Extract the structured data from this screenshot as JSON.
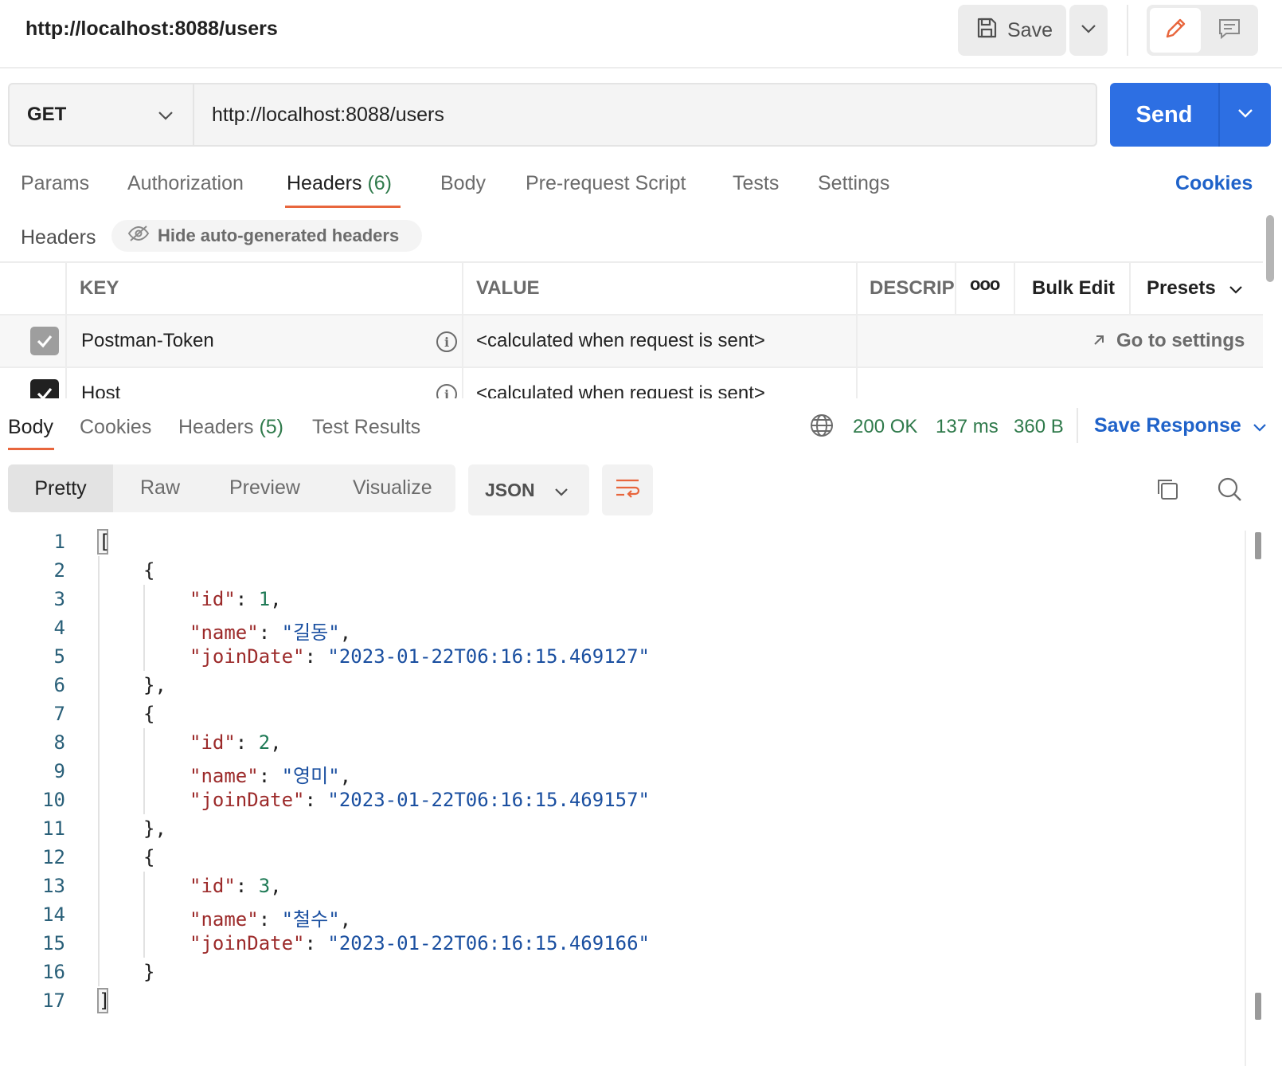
{
  "header": {
    "title": "http://localhost:8088/users",
    "save_label": "Save",
    "icons": {
      "save": "save-disk-icon",
      "caret": "chevron-down-icon",
      "edit": "pencil-icon",
      "comment": "comment-icon"
    }
  },
  "request": {
    "method": "GET",
    "url": "http://localhost:8088/users",
    "send_label": "Send"
  },
  "request_tabs": {
    "params": "Params",
    "authorization": "Authorization",
    "headers": "Headers",
    "headers_count": "(6)",
    "body": "Body",
    "pre_request": "Pre-request Script",
    "tests": "Tests",
    "settings": "Settings",
    "cookies": "Cookies"
  },
  "headers_section": {
    "label": "Headers",
    "hide_auto": "Hide auto-generated headers",
    "columns": {
      "key": "KEY",
      "value": "VALUE",
      "description": "DESCRIPT",
      "more": "ooo",
      "bulk_edit": "Bulk Edit",
      "presets": "Presets"
    },
    "rows": [
      {
        "key": "Postman-Token",
        "value": "<calculated when request is sent>",
        "action": "Go to settings",
        "checked": true
      },
      {
        "key": "Host",
        "value": "<calculated when request is sent>",
        "checked": true
      }
    ]
  },
  "response": {
    "tabs": {
      "body": "Body",
      "cookies": "Cookies",
      "headers": "Headers",
      "headers_count": "(5)",
      "test_results": "Test Results"
    },
    "status": "200 OK",
    "time": "137 ms",
    "size": "360 B",
    "save_response": "Save Response",
    "views": {
      "pretty": "Pretty",
      "raw": "Raw",
      "preview": "Preview",
      "visualize": "Visualize"
    },
    "format": "JSON",
    "colors": {
      "status": "#2f7a4b",
      "accent": "#e8663d",
      "link": "#1f62c9",
      "send": "#2d6fe3"
    }
  },
  "code": {
    "line_numbers": [
      "1",
      "2",
      "3",
      "4",
      "5",
      "6",
      "7",
      "8",
      "9",
      "10",
      "11",
      "12",
      "13",
      "14",
      "15",
      "16",
      "17"
    ],
    "users": [
      {
        "id": "1",
        "name": "\"길동\"",
        "joinDate": "\"2023-01-22T06:16:15.469127\""
      },
      {
        "id": "2",
        "name": "\"영미\"",
        "joinDate": "\"2023-01-22T06:16:15.469157\""
      },
      {
        "id": "3",
        "name": "\"철수\"",
        "joinDate": "\"2023-01-22T06:16:15.469166\""
      }
    ],
    "keys": {
      "id": "\"id\"",
      "name": "\"name\"",
      "joinDate": "\"joinDate\""
    }
  }
}
